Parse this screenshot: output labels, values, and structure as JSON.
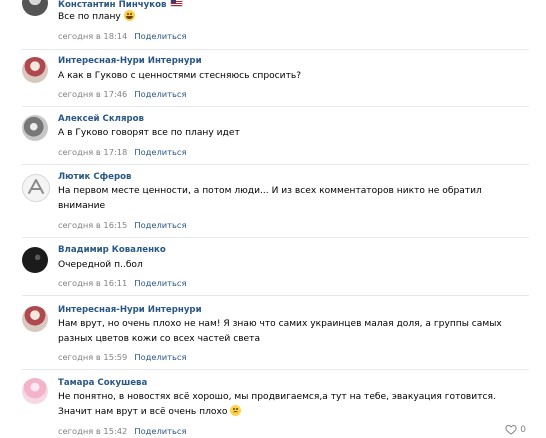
{
  "comments": [
    {
      "author": "Константин Пинчуков",
      "text": "Все по плану",
      "emoji": "rofl-emoji",
      "date": "сегодня в 18:14",
      "share": "Поделиться",
      "has_flag": true
    },
    {
      "author": "Интересная-Нури Интернури",
      "text": "А как в Гуково с ценностями стесняюсь спросить?",
      "date": "сегодня в 17:46",
      "share": "Поделиться"
    },
    {
      "author": "Алексей Скляров",
      "text": "А в Гуково говорят все по плану идет",
      "date": "сегодня в 17:18",
      "share": "Поделиться"
    },
    {
      "author": "Лютик Сферов",
      "text": "На первом месте ценности, а потом люди... И из всех комментаторов никто не обратил внимание",
      "date": "сегодня в 16:15",
      "share": "Поделиться"
    },
    {
      "author": "Владимир Коваленко",
      "text": "Очередной п..бол",
      "date": "сегодня в 16:11",
      "share": "Поделиться"
    },
    {
      "author": "Интересная-Нури Интернури",
      "text": "Нам врут, но очень плохо не нам! Я знаю что самих украинцев малая доля, а группы самых разных цветов кожи со всех частей света",
      "date": "сегодня в 15:59",
      "share": "Поделиться"
    },
    {
      "author": "Тамара Сокушева",
      "text": "Не понятно, в новостях всё хорошо, мы продвигаемся,а тут на тебе, эвакуация готовится. Значит нам врут и всё очень плохо",
      "emoji": "worried-emoji",
      "date": "сегодня в 15:42",
      "share": "Поделиться"
    }
  ],
  "likes": {
    "count": "0",
    "icon": "heart-icon"
  },
  "colors": {
    "author": "#2a5885",
    "meta": "#828282",
    "separator": "#e7e8ec"
  }
}
